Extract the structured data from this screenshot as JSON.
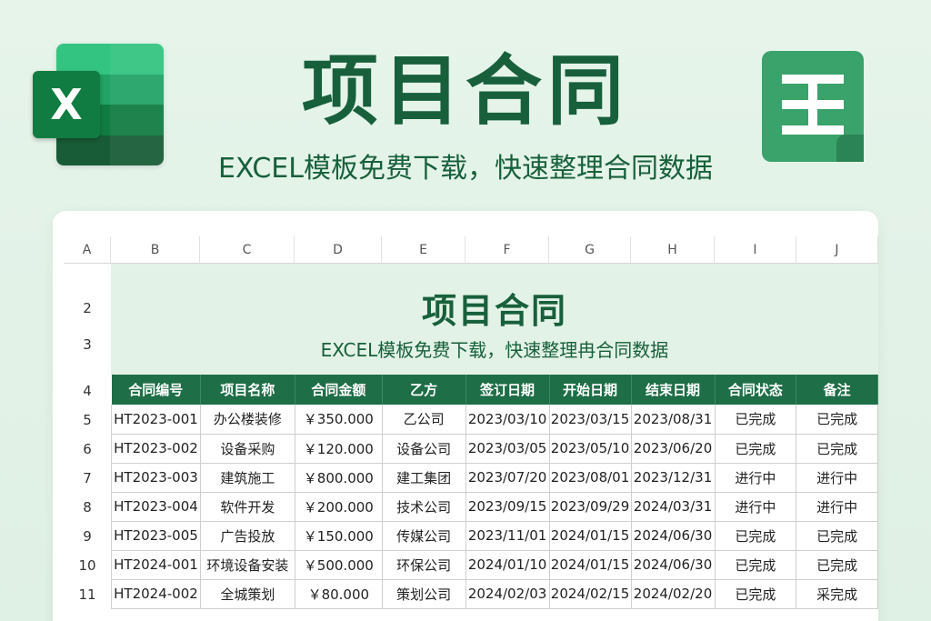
{
  "header": {
    "title": "项目合同",
    "subtitle": "EXCEL模板免费下载，快速整理合同数据"
  },
  "icons": {
    "excel": "excel-logo-icon",
    "excel_letter": "X",
    "sheets": "google-sheets-icon"
  },
  "colors": {
    "brand_green": "#17603b",
    "header_fill": "#1e6e47",
    "banner_fill": "#e3f2e6"
  },
  "sheet": {
    "columns": [
      "A",
      "B",
      "C",
      "D",
      "E",
      "F",
      "G",
      "H",
      "I",
      "J"
    ],
    "row_numbers": [
      "2",
      "3",
      "4",
      "5",
      "6",
      "7",
      "8",
      "9",
      "10",
      "11"
    ],
    "banner_title": "项目合同",
    "banner_subtitle": "EXCEL模板免费下载，快速整理冉合同数据",
    "table_headers": [
      "合同编号",
      "项目名称",
      "合同金额",
      "乙方",
      "签订日期",
      "开始日期",
      "结束日期",
      "合同状态",
      "备注"
    ],
    "rows": [
      [
        "HT2023-001",
        "办公楼装修",
        "￥350.000",
        "乙公司",
        "2023/03/10",
        "2023/03/15",
        "2023/08/31",
        "已完成",
        "已完成"
      ],
      [
        "HT2023-002",
        "设备采购",
        "￥120.000",
        "设备公司",
        "2023/03/05",
        "2023/05/10",
        "2023/06/20",
        "已完成",
        "已完成"
      ],
      [
        "HT2023-003",
        "建筑施工",
        "￥800.000",
        "建工集团",
        "2023/07/20",
        "2023/08/01",
        "2023/12/31",
        "进行中",
        "进行中"
      ],
      [
        "HT2023-004",
        "软件开发",
        "￥200.000",
        "技术公司",
        "2023/09/15",
        "2023/09/29",
        "2024/03/31",
        "进行中",
        "进行中"
      ],
      [
        "HT2023-005",
        "广告投放",
        "￥150.000",
        "传媒公司",
        "2023/11/01",
        "2024/01/15",
        "2024/06/30",
        "已完成",
        "已完成"
      ],
      [
        "HT2024-001",
        "环境设备安装",
        "￥500.000",
        "环保公司",
        "2024/01/10",
        "2024/01/15",
        "2024/06/30",
        "已完成",
        "已完成"
      ],
      [
        "HT2024-002",
        "全城策划",
        "￥80.000",
        "策划公司",
        "2024/02/03",
        "2024/02/15",
        "2024/02/20",
        "已完成",
        "采完成"
      ]
    ]
  }
}
